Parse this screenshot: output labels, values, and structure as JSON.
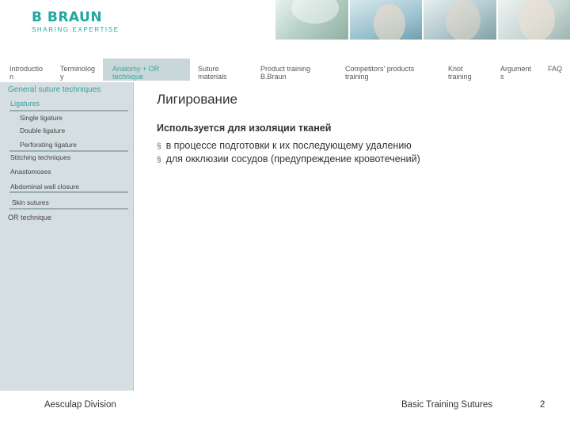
{
  "header": {
    "brand": "B BRAUN",
    "tagline": "SHARING EXPERTISE"
  },
  "nav": [
    {
      "label": "Introductio\nn"
    },
    {
      "label": "Terminolog\ny"
    },
    {
      "label": "Anatomy + OR\ntechnique",
      "active": true
    },
    {
      "label": "Suture\nmaterials"
    },
    {
      "label": "Product training\nB.Braun"
    },
    {
      "label": "Competitors' products\ntraining"
    },
    {
      "label": "Knot\ntraining"
    },
    {
      "label": "Argument\ns"
    },
    {
      "label": "FAQ"
    }
  ],
  "sidebar": {
    "section": "General suture techniques",
    "items": [
      "Ligatures",
      "Single ligature",
      "Double ligature",
      "Perforating ligature",
      "Stitching techniques",
      "Anastomoses",
      "Abdominal wall closure",
      "Skin sutures",
      "OR technique"
    ]
  },
  "content": {
    "title": "Лигирование",
    "subtitle": "Используется для изоляции тканей",
    "bullet_mark": "§",
    "bullets": [
      "в процессе подготовки к их последующему удалению",
      "для окклюзии сосудов (предупреждение кровотечений)"
    ]
  },
  "footer": {
    "left": "Aesculap Division",
    "center": "Basic Training Sutures",
    "page": "2"
  },
  "colors": {
    "accent": "#3da39b",
    "sidebar_bg": "#d5dfe2",
    "nav_active_bg": "#c9d7db"
  }
}
